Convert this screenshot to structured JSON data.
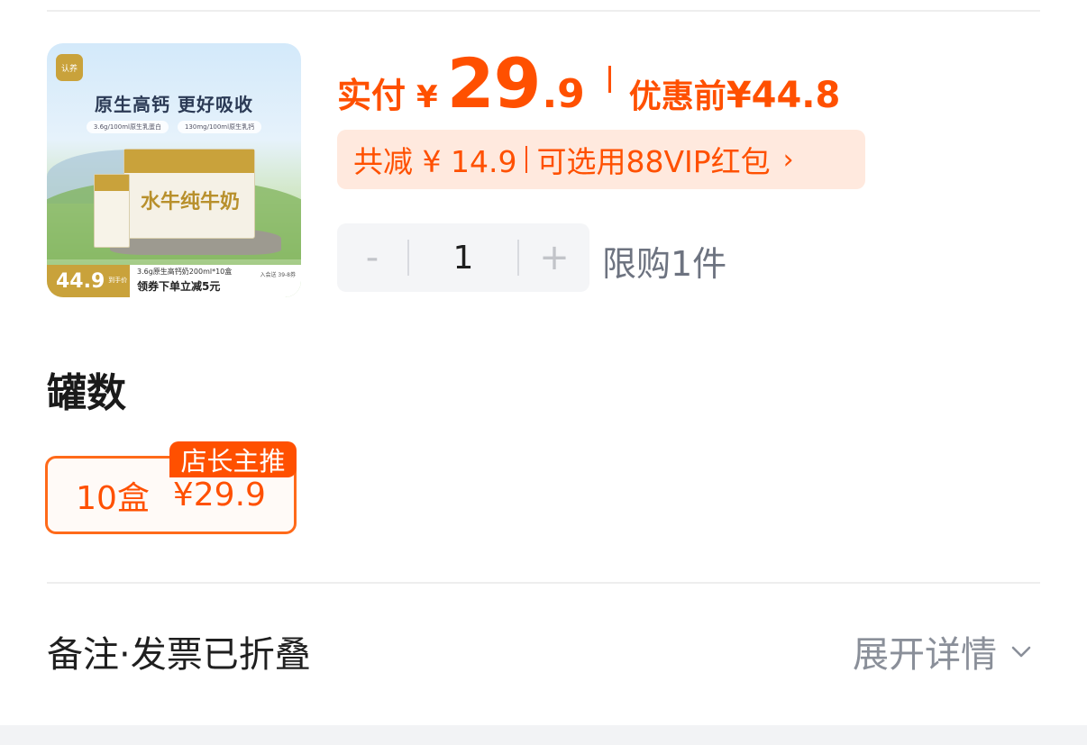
{
  "product": {
    "image": {
      "brand": "认养",
      "headline": "原生高钙 更好吸收",
      "tags": [
        "3.6g/100ml原生乳蛋白",
        "130mg/100ml原生乳钙"
      ],
      "box_title": "水牛纯牛奶",
      "price_tag": "44.9",
      "price_unit": "到手价",
      "spec": "3.6g原生高钙奶200ml*10盒",
      "coupon": "领券下单立减5元",
      "member": "入会送 39-8券"
    }
  },
  "pricing": {
    "paid_label": "实付",
    "currency": "¥",
    "price_int": "29",
    "price_dec": ".9",
    "original_label": "优惠前",
    "original_price": "¥44.8",
    "discount_text": "共减 ¥ 14.9",
    "redpacket_text": "可选用88VIP红包",
    "chevron": "›",
    "accent_color": "#ff5000",
    "discount_bg": "#ffe9de"
  },
  "quantity": {
    "minus": "-",
    "value": "1",
    "plus": "+",
    "limit": "限购1件"
  },
  "spec": {
    "title": "罐数",
    "options": [
      {
        "name": "10盒",
        "price": "¥29.9",
        "badge": "店长主推",
        "selected": true
      }
    ]
  },
  "remark": {
    "label": "备注·发票已折叠",
    "expand_label": "展开详情",
    "icon": "chevron-down-icon"
  }
}
